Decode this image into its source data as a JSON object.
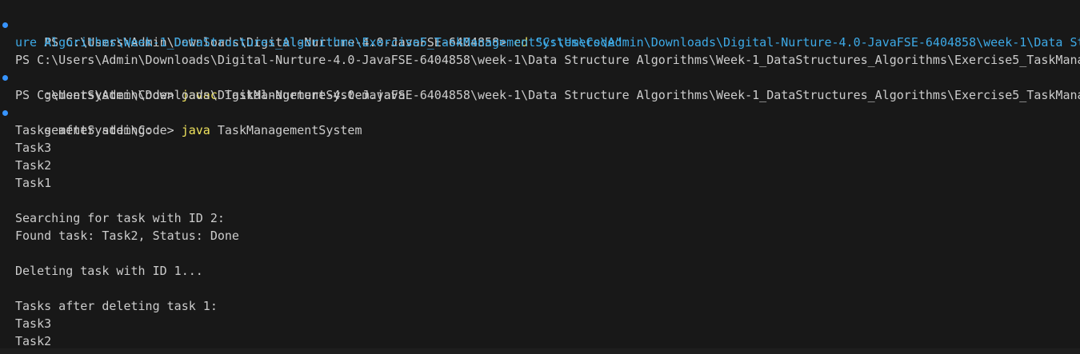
{
  "terminal": {
    "lines": [
      {
        "prompt": "PS C:\\Users\\Admin\\Downloads\\Digital-Nurture-4.0-JavaFSE-6404858> ",
        "cmd": "cd",
        "arg": " \"C:\\Users\\Admin\\Downloads\\Digital-Nurture-4.0-JavaFSE-6404858\\week-1\\Data Struct"
      },
      {
        "text": "ure Algorithms\\Week-1_DataStructures_Algorithms\\Exercise5_TaskManagementSystem\\Code\""
      },
      {
        "text": "PS C:\\Users\\Admin\\Downloads\\Digital-Nurture-4.0-JavaFSE-6404858\\week-1\\Data Structure Algorithms\\Week-1_DataStructures_Algorithms\\Exercise5_TaskMana"
      },
      {
        "prompt": "gementSystem\\Code> ",
        "cmd": "javac",
        "arg": " TaskManagementSystem.java"
      },
      {
        "text": "PS C:\\Users\\Admin\\Downloads\\Digital-Nurture-4.0-JavaFSE-6404858\\week-1\\Data Structure Algorithms\\Week-1_DataStructures_Algorithms\\Exercise5_TaskMana"
      },
      {
        "prompt": "gementSystem\\Code> ",
        "cmd": "java",
        "arg": " TaskManagementSystem"
      },
      {
        "text": "Tasks after adding:"
      },
      {
        "text": "Task3"
      },
      {
        "text": "Task2"
      },
      {
        "text": "Task1"
      },
      {
        "text": ""
      },
      {
        "text": "Searching for task with ID 2:"
      },
      {
        "text": "Found task: Task2, Status: Done"
      },
      {
        "text": ""
      },
      {
        "text": "Deleting task with ID 1..."
      },
      {
        "text": ""
      },
      {
        "text": "Tasks after deleting task 1:"
      },
      {
        "text": "Task3"
      },
      {
        "text": "Task2"
      }
    ]
  },
  "colors": {
    "background": "#181818",
    "foreground": "#cccccc",
    "command": "#f0e45e",
    "string": "#3da9e6",
    "decoration": "#3794ff"
  }
}
